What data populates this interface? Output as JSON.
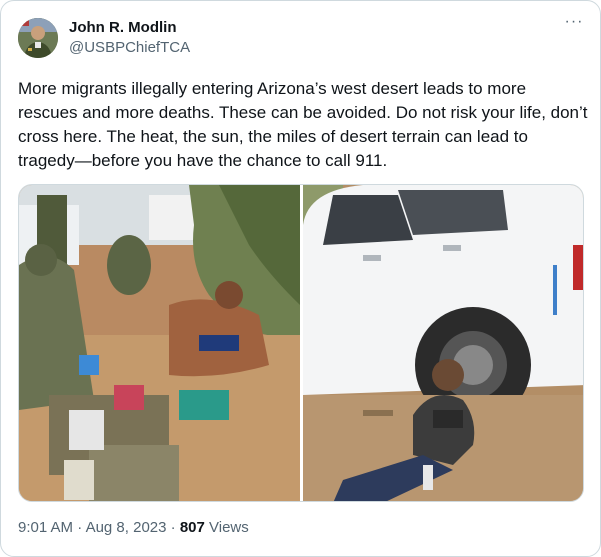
{
  "author": {
    "name": "John R. Modlin",
    "handle": "@USBPChiefTCA"
  },
  "more_icon": "more-horizontal-icon",
  "tweet": {
    "text": "More migrants illegally entering Arizona’s west desert leads to more rescues and more deaths. These can be avoided. Do not risk your life, don’t cross here. The heat, the sun, the miles of desert terrain can lead to tragedy—before you have the chance to call 911."
  },
  "meta": {
    "time": "9:01 AM",
    "separator": "·",
    "date": "Aug 8, 2023",
    "views_count": "807",
    "views_label": "Views"
  },
  "colors": {
    "text_primary": "#0f1419",
    "text_secondary": "#536471",
    "border": "#cfd9de"
  }
}
